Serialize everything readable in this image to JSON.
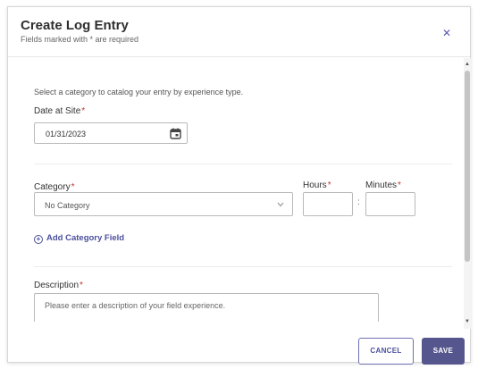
{
  "modal": {
    "title": "Create Log Entry",
    "subtitle": "Fields marked with * are required",
    "close_icon": "close-icon"
  },
  "form": {
    "intro": "Select a category to catalog your entry by experience type.",
    "date": {
      "label": "Date at Site",
      "required_mark": "*",
      "value": "01/31/2023",
      "icon": "calendar-icon"
    },
    "category": {
      "label": "Category",
      "required_mark": "*",
      "selected": "No Category",
      "icon": "chevron-down-icon"
    },
    "hours": {
      "label": "Hours",
      "required_mark": "*",
      "value": ""
    },
    "separator": ":",
    "minutes": {
      "label": "Minutes",
      "required_mark": "*",
      "value": ""
    },
    "add_category_field": {
      "icon": "plus-circle-icon",
      "label": "Add Category Field"
    },
    "description": {
      "label": "Description",
      "required_mark": "*",
      "placeholder": "Please enter a description of your field experience."
    }
  },
  "footer": {
    "cancel_label": "CANCEL",
    "save_label": "SAVE"
  },
  "colors": {
    "accent": "#55568e",
    "link": "#4b4f9d",
    "required": "#c0392b"
  }
}
